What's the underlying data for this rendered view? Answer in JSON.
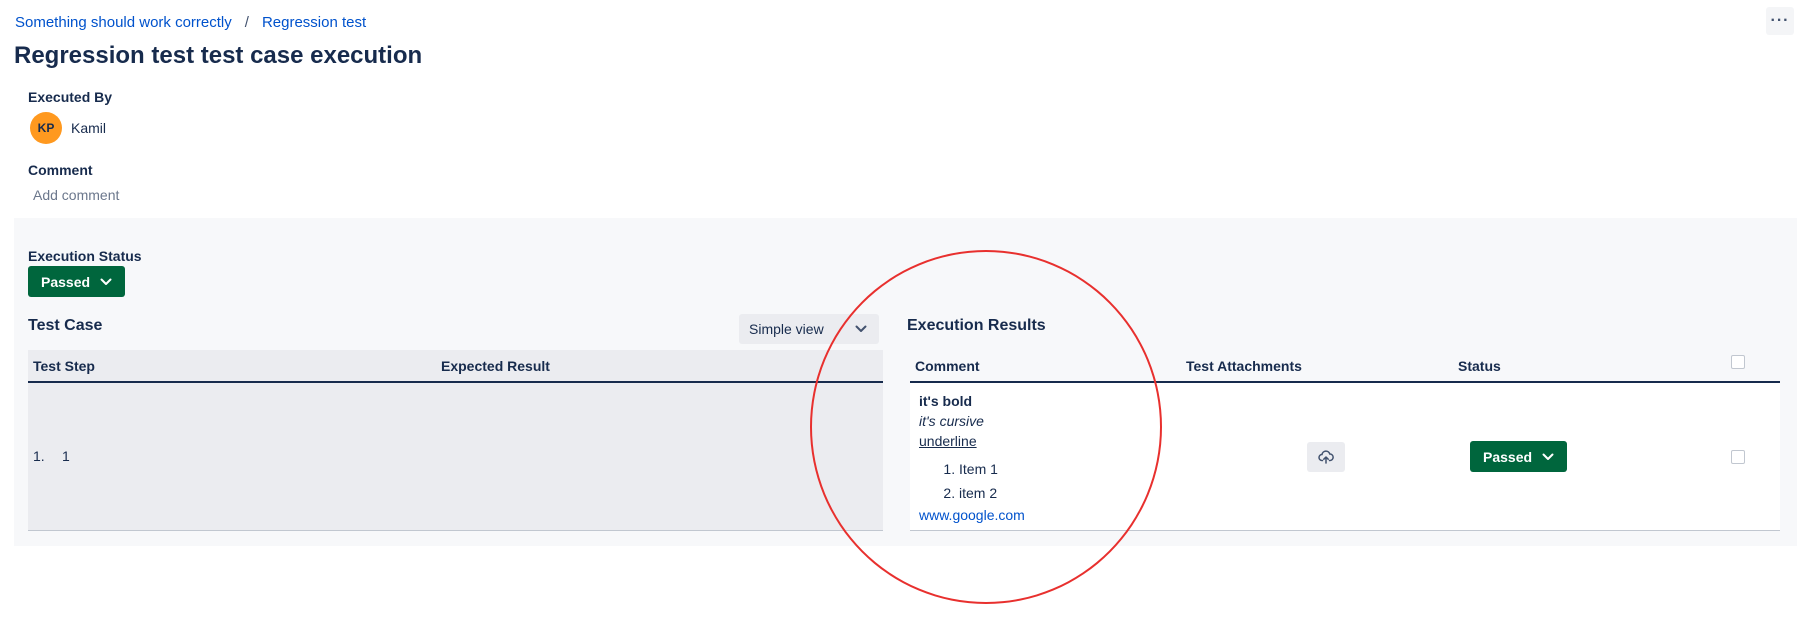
{
  "breadcrumb": {
    "items": [
      "Something should work correctly",
      "Regression test"
    ],
    "separator": "/"
  },
  "page": {
    "title": "Regression test test case execution",
    "more_label": "···"
  },
  "executor": {
    "label": "Executed By",
    "initials": "KP",
    "name": "Kamil",
    "avatar_color": "#ff991f"
  },
  "comment": {
    "label": "Comment",
    "placeholder": "Add comment"
  },
  "execution_status": {
    "label": "Execution Status",
    "value": "Passed",
    "color": "#00663d"
  },
  "test_case": {
    "title": "Test Case",
    "view_select": "Simple view",
    "columns": [
      "Test Step",
      "Expected Result"
    ],
    "rows": [
      {
        "number": "1.",
        "step": "1",
        "expected": ""
      }
    ]
  },
  "execution_results": {
    "title": "Execution Results",
    "columns": [
      "Comment",
      "Test Attachments",
      "Status"
    ],
    "rows": [
      {
        "comment": {
          "bold": "it's bold",
          "italic": "it's cursive",
          "underline": "underline",
          "list": [
            "Item 1",
            "item 2"
          ],
          "link": "www.google.com"
        },
        "attachment_icon": "cloud-upload-icon",
        "status": "Passed"
      }
    ]
  },
  "annotation_color": "#e8302e"
}
